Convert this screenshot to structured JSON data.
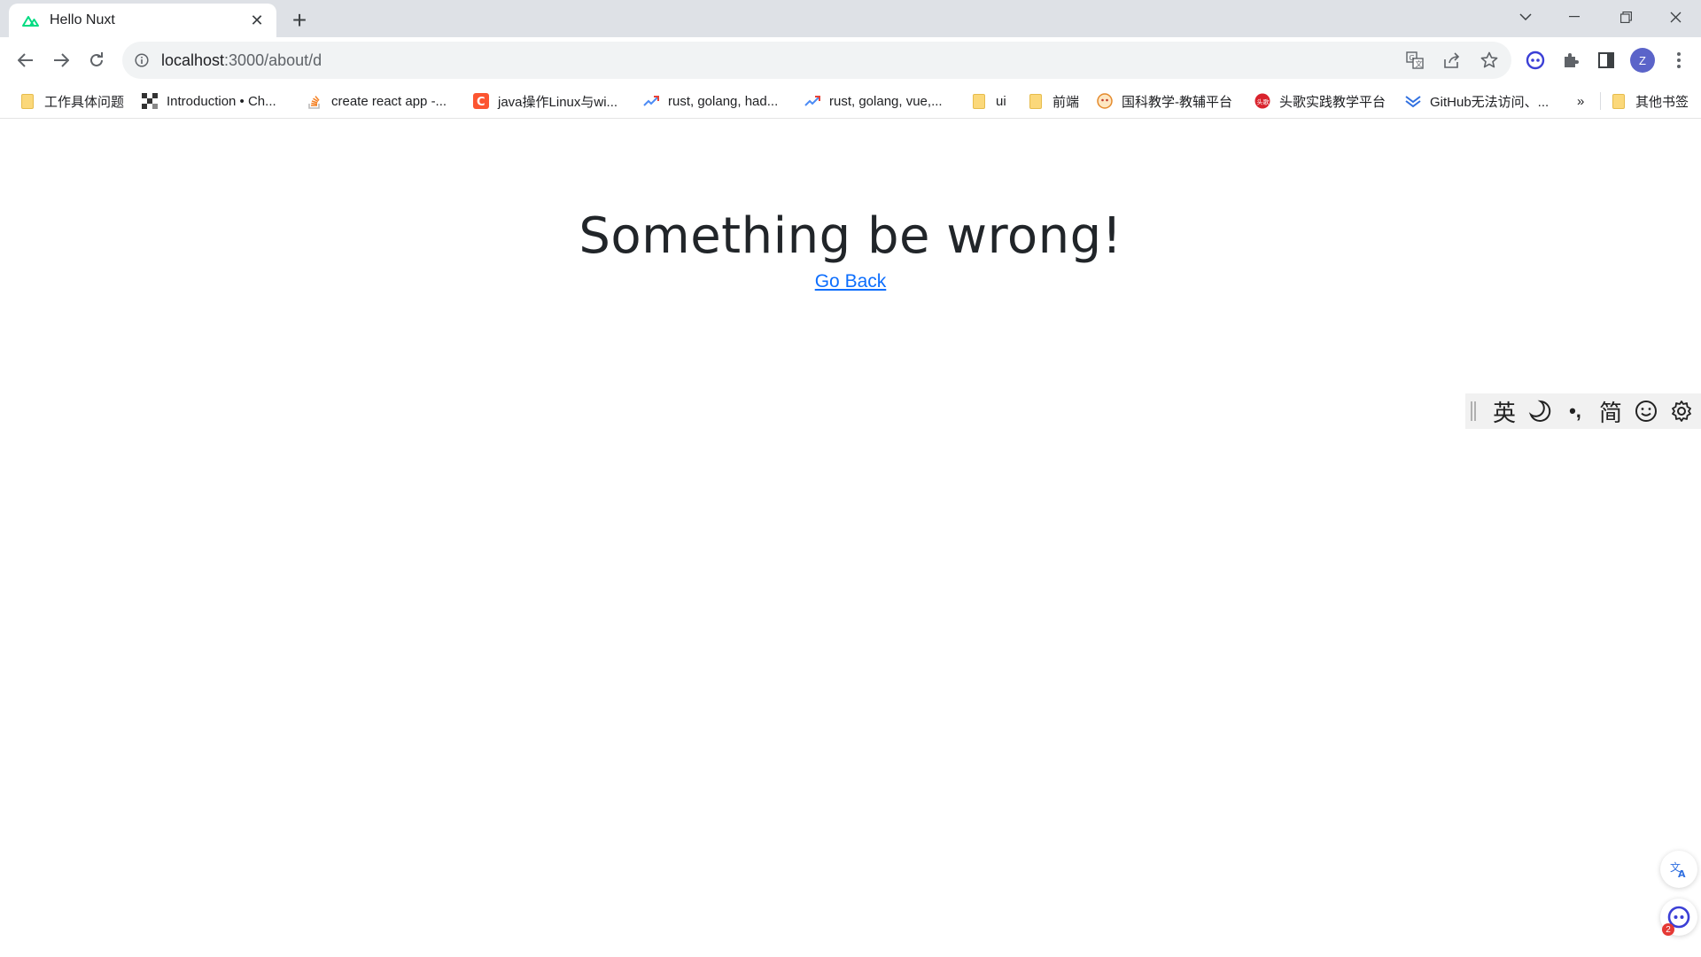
{
  "browser": {
    "tab_title": "Hello Nuxt",
    "tab_close": "✕",
    "new_tab": "+",
    "url_host": "localhost",
    "url_path": ":3000/about/d",
    "profile_initial": "Z"
  },
  "bookmarks": [
    {
      "label": "工作具体问题",
      "icon": "folder-icon"
    },
    {
      "label": "Introduction • Ch...",
      "icon": "site-icon"
    },
    {
      "label": "create react app -...",
      "icon": "stackoverflow-icon"
    },
    {
      "label": "java操作Linux与wi...",
      "icon": "csdn-icon"
    },
    {
      "label": "rust, golang, had...",
      "icon": "trend-icon"
    },
    {
      "label": "rust, golang, vue,...",
      "icon": "trend-icon"
    },
    {
      "label": "ui",
      "icon": "folder-icon"
    },
    {
      "label": "前端",
      "icon": "folder-icon"
    },
    {
      "label": "国科教学-教辅平台",
      "icon": "site-icon"
    },
    {
      "label": "头歌实践教学平台",
      "icon": "site-icon"
    },
    {
      "label": "GitHub无法访问、...",
      "icon": "site-icon"
    }
  ],
  "bookmarks_more": "»",
  "other_bookmarks": "其他书签",
  "page": {
    "headline": "Something be wrong!",
    "link": "Go Back"
  },
  "ime": {
    "lang": "英",
    "punct": "•,",
    "charset": "简"
  },
  "badge_count": "2",
  "colors": {
    "link": "#0d6efd",
    "nuxt_green": "#00dc82",
    "avatar": "#5b64c9"
  }
}
